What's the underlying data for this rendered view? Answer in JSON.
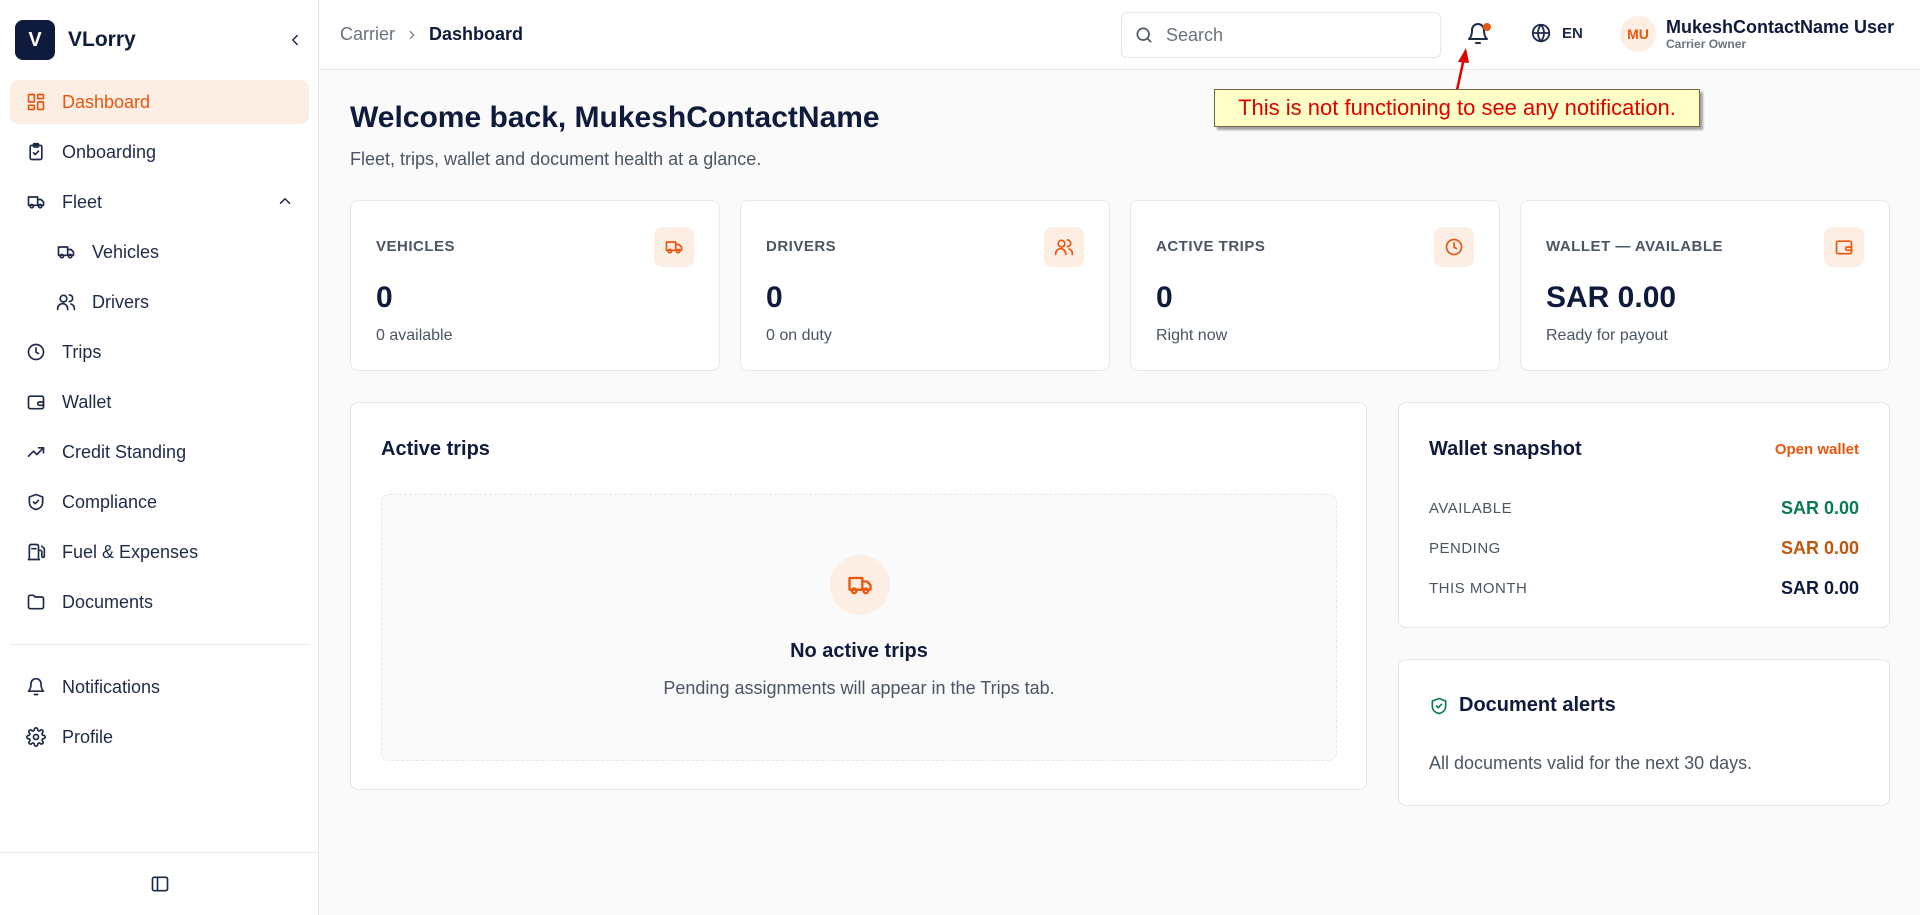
{
  "brand": {
    "logo_letter": "V",
    "name": "VLorry"
  },
  "sidebar": {
    "items": [
      {
        "label": "Dashboard",
        "icon": "dashboard-icon"
      },
      {
        "label": "Onboarding",
        "icon": "clipboard-icon"
      },
      {
        "label": "Fleet",
        "icon": "truck-icon"
      },
      {
        "label": "Vehicles",
        "icon": "truck-icon"
      },
      {
        "label": "Drivers",
        "icon": "users-icon"
      },
      {
        "label": "Trips",
        "icon": "clock-icon"
      },
      {
        "label": "Wallet",
        "icon": "wallet-icon"
      },
      {
        "label": "Credit Standing",
        "icon": "trending-up-icon"
      },
      {
        "label": "Compliance",
        "icon": "shield-icon"
      },
      {
        "label": "Fuel & Expenses",
        "icon": "fuel-icon"
      },
      {
        "label": "Documents",
        "icon": "folder-icon"
      },
      {
        "label": "Notifications",
        "icon": "bell-icon"
      },
      {
        "label": "Profile",
        "icon": "gear-icon"
      }
    ]
  },
  "breadcrumb": {
    "parent": "Carrier",
    "current": "Dashboard"
  },
  "search": {
    "placeholder": "Search"
  },
  "language": {
    "code": "EN"
  },
  "user": {
    "initials": "MU",
    "name": "MukeshContactName User",
    "role": "Carrier Owner"
  },
  "annotation": {
    "text": "This is not functioning to see any notification."
  },
  "header": {
    "welcome": "Welcome back, MukeshContactName",
    "subtitle": "Fleet, trips, wallet and document health at a glance."
  },
  "stats": [
    {
      "label": "VEHICLES",
      "value": "0",
      "sub": "0 available",
      "icon": "truck-icon"
    },
    {
      "label": "DRIVERS",
      "value": "0",
      "sub": "0 on duty",
      "icon": "users-icon"
    },
    {
      "label": "ACTIVE TRIPS",
      "value": "0",
      "sub": "Right now",
      "icon": "clock-icon"
    },
    {
      "label": "WALLET — AVAILABLE",
      "value": "SAR 0.00",
      "sub": "Ready for payout",
      "icon": "wallet-icon"
    }
  ],
  "active_trips": {
    "title": "Active trips",
    "empty_title": "No active trips",
    "empty_sub": "Pending assignments will appear in the Trips tab."
  },
  "wallet_snapshot": {
    "title": "Wallet snapshot",
    "link": "Open wallet",
    "rows": [
      {
        "label": "AVAILABLE",
        "value": "SAR 0.00",
        "color": "#0a7a55"
      },
      {
        "label": "PENDING",
        "value": "SAR 0.00",
        "color": "#c2570c"
      },
      {
        "label": "THIS MONTH",
        "value": "SAR 0.00",
        "color": "#0f1b3d"
      }
    ]
  },
  "document_alerts": {
    "title": "Document alerts",
    "text": "All documents valid for the next 30 days."
  },
  "colors": {
    "accent": "#e8560f",
    "accent_bg": "#fdeee4",
    "navy": "#0f1b3d"
  }
}
